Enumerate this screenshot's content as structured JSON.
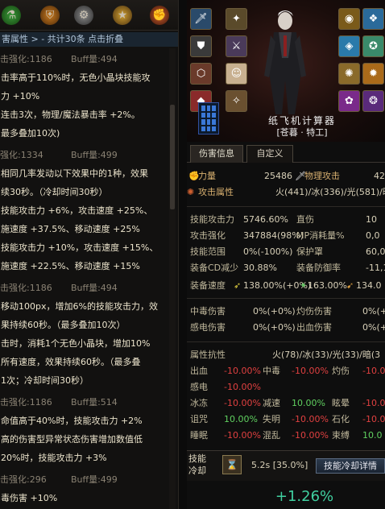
{
  "left": {
    "header": "害属性 > - 共计30条 点击折叠",
    "blocks": [
      {
        "head_name": "击强化:1186",
        "head_buff": "Buff量:494",
        "lines": [
          "击率高于110%时，无色小晶块技能攻",
          "力 +10%",
          "连击3次，物理/魔法暴击率 +2%。",
          "最多叠加10次)"
        ]
      },
      {
        "head_name": "强化:1334",
        "head_buff": "Buff量:499",
        "lines": [
          "相同几率发动以下效果中的1种，效果",
          "续30秒。（冷却时间30秒）",
          "技能攻击力 +6%，攻击速度 +25%、",
          "施速度 +37.5%、移动速度 +25%",
          "技能攻击力 +10%，攻击速度 +15%、",
          "施速度 +22.5%、移动速度 +15%"
        ]
      },
      {
        "head_name": "击强化:1186",
        "head_buff": "Buff量:494",
        "lines": [
          "移动100px，增加6%的技能攻击力，效",
          "果持续60秒。（最多叠加10次）",
          "击时，消耗1个无色小晶块，增加10%",
          "所有速度，效果持续60秒。（最多叠",
          "1次；冷却时间30秒）"
        ]
      },
      {
        "head_name": "击强化:1186",
        "head_buff": "Buff量:514",
        "lines": [
          "命值高于40%时，技能攻击力 +2%",
          "高的伤害型异常状态伤害增加数值低",
          "20%时，技能攻击力 +3%"
        ]
      },
      {
        "head_name": "击强化:296",
        "head_buff": "Buff量:499",
        "lines": [
          "毒伤害 +10%"
        ]
      }
    ]
  },
  "right": {
    "calculator_name": "纸飞机计算器",
    "class_name": "[苍暮 · 特工]",
    "tabs": [
      "伤害信息",
      "自定义"
    ],
    "main_stats": {
      "strength_label": "力量",
      "strength_value": "25486",
      "phys_atk_label": "物理攻击",
      "phys_atk_value": "42",
      "attack_attr_label": "攻击属性",
      "attack_attr_value": "火(441)/冰(336)/光(581)/暗(33"
    },
    "detail_stats": [
      {
        "l1": "技能攻击力",
        "v1": "5746.60%",
        "l2": "直伤",
        "v2": "10"
      },
      {
        "l1": "攻击强化",
        "v1": "347884(98%)",
        "l2": "MP消耗量%",
        "v2": "0,0"
      },
      {
        "l1": "技能范围",
        "v1": "0%(-100%)",
        "l2": "保护罩",
        "v2": "60,0"
      },
      {
        "l1": "装备CD减少",
        "v1": "30.88%",
        "l2": "装备防御率",
        "v2": "-11,1"
      }
    ],
    "equip_speed": {
      "label": "装备速度",
      "v1": "138.00%(+0%)",
      "v2": "163.00%",
      "v3": "134.0"
    },
    "dot_stats": [
      {
        "l1": "中毒伤害",
        "v1": "0%(+0%)",
        "l2": "灼伤伤害",
        "v2": "0%(+0"
      },
      {
        "l1": "感电伤害",
        "v1": "0%(+0%)",
        "l2": "出血伤害",
        "v2": "0%(+0"
      }
    ],
    "resist": {
      "label": "属性抗性",
      "values": "火(78)/冰(33)/光(33)/暗(3",
      "rows": [
        [
          {
            "n": "出血",
            "v": "-10.00%"
          },
          {
            "n": "中毒",
            "v": "-10.00%"
          },
          {
            "n": "灼伤",
            "v": "-10.0"
          }
        ],
        [
          {
            "n": "感电",
            "v": "-10.00%"
          }
        ],
        [
          {
            "n": "冰冻",
            "v": "-10.00%"
          },
          {
            "n": "减速",
            "v": "10.00%"
          },
          {
            "n": "眩晕",
            "v": "-10.0"
          }
        ],
        [
          {
            "n": "诅咒",
            "v": "10.00%"
          },
          {
            "n": "失明",
            "v": "-10.00%"
          },
          {
            "n": "石化",
            "v": "-10.0"
          }
        ],
        [
          {
            "n": "睡眠",
            "v": "-10.00%"
          },
          {
            "n": "混乱",
            "v": "-10.00%"
          },
          {
            "n": "束缚",
            "v": "10.0"
          }
        ]
      ]
    },
    "skill_cd": {
      "label_top": "技能",
      "label_bottom": "冷却",
      "value": "5.2s [35.0%]",
      "button": "技能冷却详情"
    },
    "bottom_value": "+1.26%"
  }
}
